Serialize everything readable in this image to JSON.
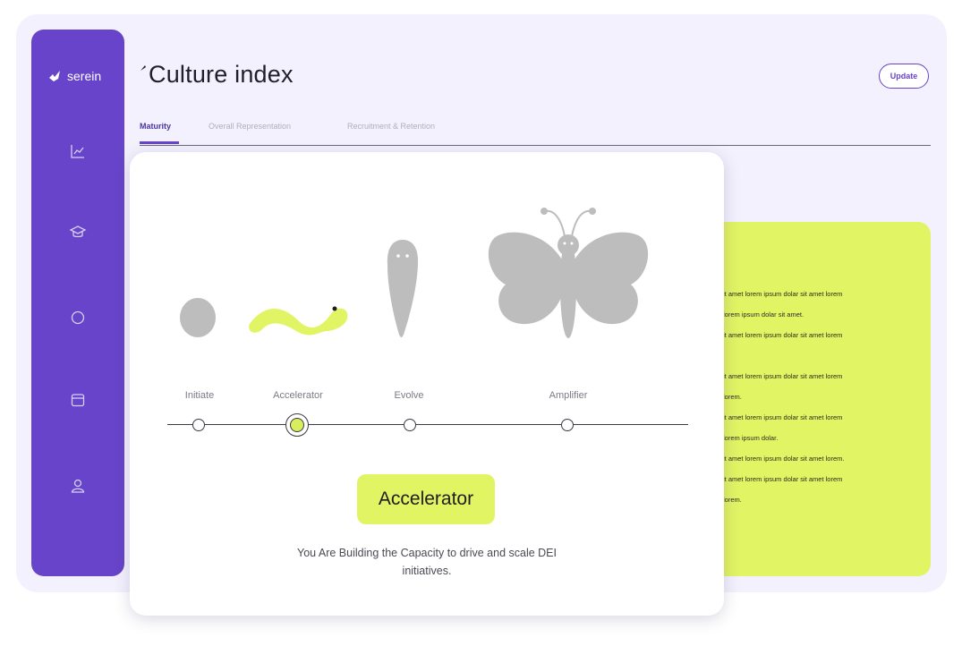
{
  "brand": {
    "name": "serein"
  },
  "sidebar": {
    "items": [
      {
        "icon": "chart-icon"
      },
      {
        "icon": "graduation-cap-icon"
      },
      {
        "icon": "circle-icon"
      },
      {
        "icon": "calendar-icon"
      },
      {
        "icon": "user-icon"
      }
    ]
  },
  "header": {
    "title": "Culture index",
    "update_label": "Update"
  },
  "tabs": [
    {
      "label": "Maturity",
      "active": true
    },
    {
      "label": "Overall Representation",
      "active": false
    },
    {
      "label": "Recruitment & Retention",
      "active": false
    }
  ],
  "lime_panel": {
    "lines": [
      "it amet lorem ipsum dolar sit amet lorem",
      "lorem ipsum dolar sit amet.",
      "it amet lorem ipsum dolar sit amet lorem",
      "it amet lorem ipsum dolar sit amet lorem",
      "lorem.",
      "it amet lorem ipsum dolar sit amet lorem",
      "lorem ipsum dolar.",
      "it amet lorem ipsum dolar sit amet lorem.",
      "it amet lorem ipsum dolar sit amet lorem",
      "lorem."
    ]
  },
  "maturity": {
    "stages": [
      {
        "label": "Initiate",
        "icon": "egg-icon"
      },
      {
        "label": "Accelerator",
        "icon": "caterpillar-icon"
      },
      {
        "label": "Evolve",
        "icon": "cocoon-icon"
      },
      {
        "label": "Amplifier",
        "icon": "butterfly-icon"
      }
    ],
    "current_stage": "Accelerator",
    "description": "You Are Building the Capacity to drive and scale DEI initiatives."
  },
  "colors": {
    "accent": "#6744c9",
    "highlight": "#e1f464",
    "art_gray": "#bdbdbd"
  }
}
